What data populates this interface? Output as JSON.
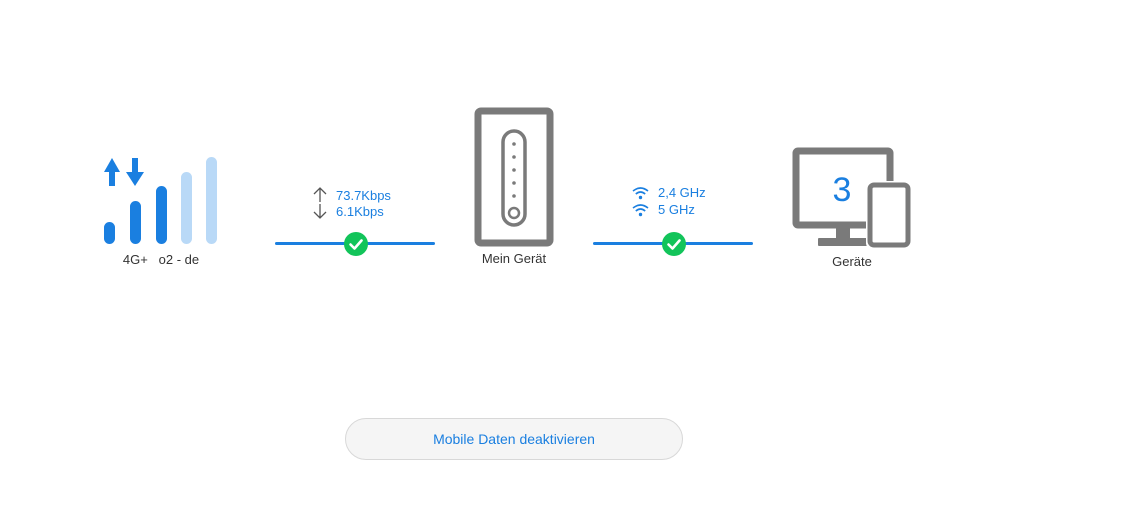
{
  "network": {
    "type": "4G+",
    "provider": "o2 - de",
    "signal_bars_total": 5,
    "signal_bars_active": 3
  },
  "wan_link": {
    "upload": "73.7Kbps",
    "download": "6.1Kbps",
    "status": "connected"
  },
  "router": {
    "label": "Mein Gerät"
  },
  "wifi_link": {
    "band_1": "2,4 GHz",
    "band_2": "5 GHz",
    "status": "connected"
  },
  "devices": {
    "count": "3",
    "label": "Geräte"
  },
  "actions": {
    "mobile_data_button": "Mobile Daten deaktivieren"
  },
  "colors": {
    "accent": "#1a7fe0",
    "accent_light": "#b9d9f7",
    "success": "#12c45a",
    "icon_gray": "#7a7a7a",
    "text": "#333333"
  }
}
